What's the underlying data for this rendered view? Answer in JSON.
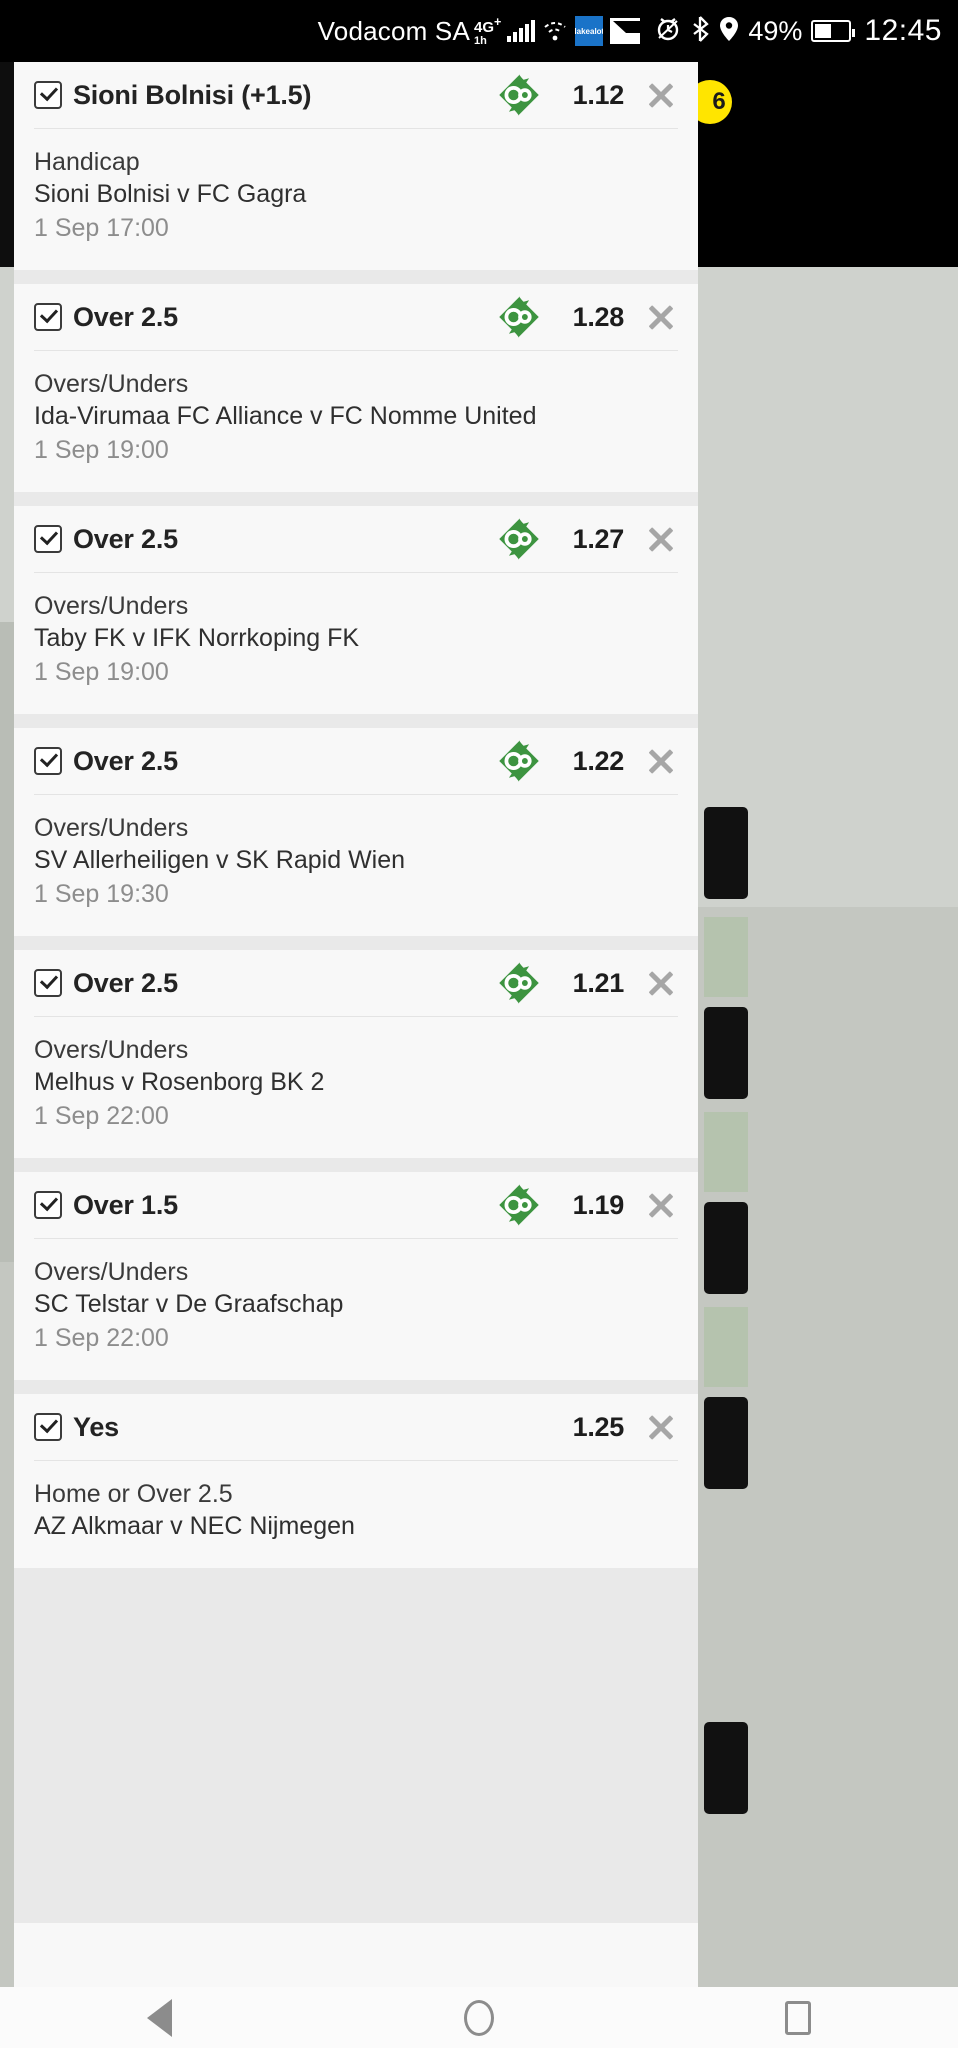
{
  "status_bar": {
    "carrier": "Vodacom SA",
    "network_type_top": "4G",
    "network_type_plus": "+",
    "network_type_bottom": "1h",
    "blue_badge_label": "lakealot",
    "battery_percent": "49%",
    "battery_level": 49,
    "clock": "12:45",
    "icons": [
      "signal-bars-icon",
      "wifi-icon",
      "app-badge-icon",
      "mail-icon",
      "alarm-icon",
      "bluetooth-icon",
      "location-icon",
      "battery-icon"
    ]
  },
  "overlay": {
    "badge_count": "6",
    "badge_color": "#ffe500"
  },
  "theme": {
    "card_bg": "#f8f8f8",
    "panel_bg": "#e9e9e9",
    "logo_green": "#3d9440",
    "odds_color": "#1d1d1d",
    "muted_text": "#8d8d8d",
    "close_icon_color": "#a6a6a6"
  },
  "betslip": {
    "items": [
      {
        "selection": "Sioni Bolnisi (+1.5)",
        "odds": "1.12",
        "market": "Handicap",
        "fixture": "Sioni Bolnisi v FC Gagra",
        "datetime": "1 Sep 17:00",
        "checked": true,
        "has_logo": true,
        "logo": "co-logo-icon",
        "remove_label": "remove-icon"
      },
      {
        "selection": "Over 2.5",
        "odds": "1.28",
        "market": "Overs/Unders",
        "fixture": "Ida-Virumaa FC Alliance v FC Nomme United",
        "datetime": "1 Sep 19:00",
        "checked": true,
        "has_logo": true,
        "logo": "co-logo-icon",
        "remove_label": "remove-icon"
      },
      {
        "selection": "Over 2.5",
        "odds": "1.27",
        "market": "Overs/Unders",
        "fixture": "Taby FK v IFK Norrkoping FK",
        "datetime": "1 Sep 19:00",
        "checked": true,
        "has_logo": true,
        "logo": "co-logo-icon",
        "remove_label": "remove-icon"
      },
      {
        "selection": "Over 2.5",
        "odds": "1.22",
        "market": "Overs/Unders",
        "fixture": "SV Allerheiligen v SK Rapid Wien",
        "datetime": "1 Sep 19:30",
        "checked": true,
        "has_logo": true,
        "logo": "co-logo-icon",
        "remove_label": "remove-icon"
      },
      {
        "selection": "Over 2.5",
        "odds": "1.21",
        "market": "Overs/Unders",
        "fixture": "Melhus v Rosenborg BK 2",
        "datetime": "1 Sep 22:00",
        "checked": true,
        "has_logo": true,
        "logo": "co-logo-icon",
        "remove_label": "remove-icon"
      },
      {
        "selection": "Over 1.5",
        "odds": "1.19",
        "market": "Overs/Unders",
        "fixture": "SC Telstar v De Graafschap",
        "datetime": "1 Sep 22:00",
        "checked": true,
        "has_logo": true,
        "logo": "co-logo-icon",
        "remove_label": "remove-icon"
      },
      {
        "selection": "Yes",
        "odds": "1.25",
        "market": "Home or Over 2.5",
        "fixture": "AZ Alkmaar v NEC Nijmegen",
        "datetime": "",
        "checked": true,
        "has_logo": false,
        "logo": "",
        "remove_label": "remove-icon"
      }
    ]
  },
  "clipped_below_nav": {
    "text": "AZ Alkmaar v NEC Nijmegen"
  },
  "nav_bar": {
    "back": "back-triangle-icon",
    "home": "home-circle-icon",
    "recents": "recents-square-icon"
  }
}
